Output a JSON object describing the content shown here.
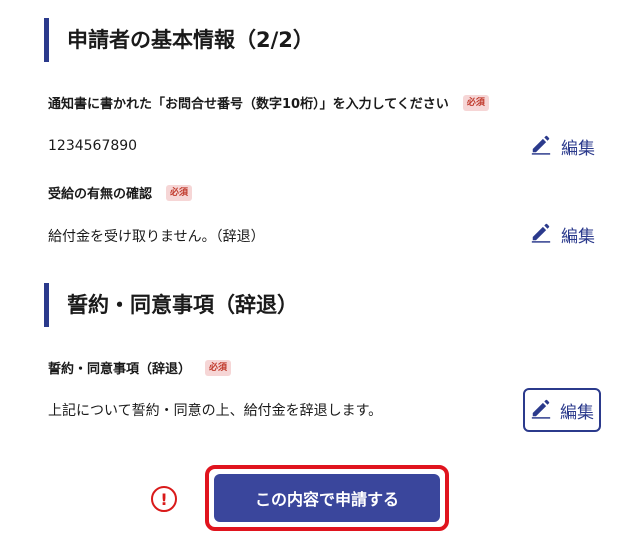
{
  "section1": {
    "heading": "申請者の基本情報（2/2）",
    "fields": [
      {
        "label": "通知書に書かれた「お問合せ番号（数字10桁）」を入力してください",
        "badge": "必須",
        "value": "1234567890",
        "edit_label": "編集"
      },
      {
        "label": "受給の有無の確認",
        "badge": "必須",
        "value": "給付金を受け取りません。（辞退）",
        "edit_label": "編集"
      }
    ]
  },
  "section2": {
    "heading": "誓約・同意事項（辞退）",
    "fields": [
      {
        "label": "誓約・同意事項（辞退）",
        "badge": "必須",
        "value": "上記について誓約・同意の上、給付金を辞退します。",
        "edit_label": "編集"
      }
    ]
  },
  "footer": {
    "notice_symbol": "!",
    "submit_label": "この内容で申請する"
  },
  "colors": {
    "accent": "#2b3a8c",
    "button": "#3a469c",
    "highlight": "#e0141e",
    "badge_bg": "#f6d6d6",
    "badge_text": "#c0392b"
  },
  "icons": {
    "edit": "pencil-icon",
    "notice": "exclamation-circle-icon"
  }
}
